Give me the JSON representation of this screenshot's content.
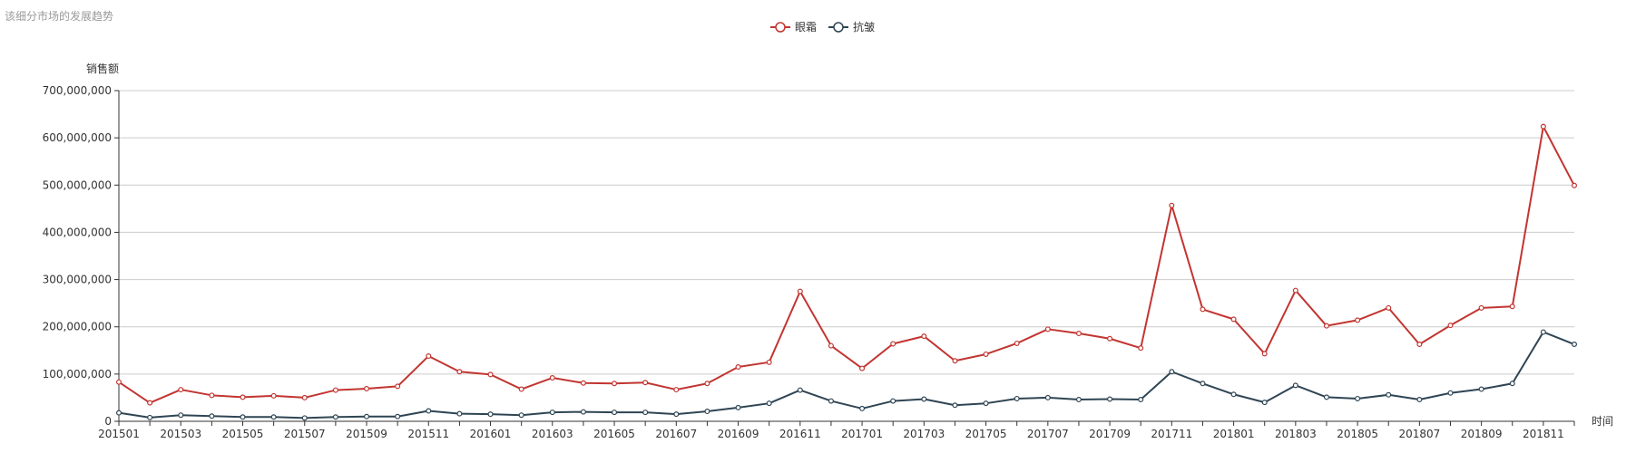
{
  "page": {
    "title": "该细分市场的发展趋势"
  },
  "chart_data": {
    "type": "line",
    "ylabel": "销售额",
    "xlabel": "时间",
    "ylim": [
      0,
      700000000
    ],
    "y_ticks": [
      0,
      100000000,
      200000000,
      300000000,
      400000000,
      500000000,
      600000000,
      700000000
    ],
    "y_tick_labels": [
      "0",
      "100,000,000",
      "200,000,000",
      "300,000,000",
      "400,000,000",
      "500,000,000",
      "600,000,000",
      "700,000,000"
    ],
    "grid": true,
    "legend_position": "top-center",
    "x": [
      "201501",
      "201502",
      "201503",
      "201504",
      "201505",
      "201506",
      "201507",
      "201508",
      "201509",
      "201510",
      "201511",
      "201512",
      "201601",
      "201602",
      "201603",
      "201604",
      "201605",
      "201606",
      "201607",
      "201608",
      "201609",
      "201610",
      "201611",
      "201612",
      "201701",
      "201702",
      "201703",
      "201704",
      "201705",
      "201706",
      "201707",
      "201708",
      "201709",
      "201710",
      "201711",
      "201712",
      "201801",
      "201802",
      "201803",
      "201804",
      "201805",
      "201806",
      "201807",
      "201808",
      "201809",
      "201810",
      "201811",
      "201812"
    ],
    "x_tick_labels": [
      "201501",
      "201503",
      "201505",
      "201507",
      "201509",
      "201511",
      "201601",
      "201603",
      "201605",
      "201607",
      "201609",
      "201611",
      "201701",
      "201703",
      "201705",
      "201707",
      "201709",
      "201711",
      "201801",
      "201803",
      "201805",
      "201807",
      "201809",
      "201811"
    ],
    "series": [
      {
        "name": "眼霜",
        "color": "#c23531",
        "values": [
          83000000,
          39000000,
          67000000,
          55000000,
          51000000,
          54000000,
          50000000,
          66000000,
          69000000,
          74000000,
          138000000,
          105000000,
          99000000,
          68000000,
          92000000,
          81000000,
          80000000,
          82000000,
          67000000,
          80000000,
          115000000,
          125000000,
          275000000,
          160000000,
          112000000,
          164000000,
          180000000,
          128000000,
          142000000,
          165000000,
          195000000,
          186000000,
          175000000,
          155000000,
          457000000,
          237000000,
          216000000,
          143000000,
          277000000,
          202000000,
          214000000,
          240000000,
          163000000,
          203000000,
          240000000,
          243000000,
          624000000,
          499000000
        ]
      },
      {
        "name": "抗皱",
        "color": "#2f4554",
        "values": [
          18000000,
          8000000,
          13000000,
          11000000,
          9000000,
          9000000,
          7000000,
          9000000,
          10000000,
          10000000,
          22000000,
          16000000,
          15000000,
          13000000,
          19000000,
          20000000,
          19000000,
          19000000,
          15000000,
          21000000,
          29000000,
          38000000,
          66000000,
          43000000,
          27000000,
          43000000,
          47000000,
          34000000,
          38000000,
          48000000,
          50000000,
          46000000,
          47000000,
          46000000,
          105000000,
          80000000,
          57000000,
          40000000,
          76000000,
          51000000,
          48000000,
          56000000,
          46000000,
          60000000,
          68000000,
          80000000,
          189000000,
          163000000
        ]
      }
    ]
  }
}
